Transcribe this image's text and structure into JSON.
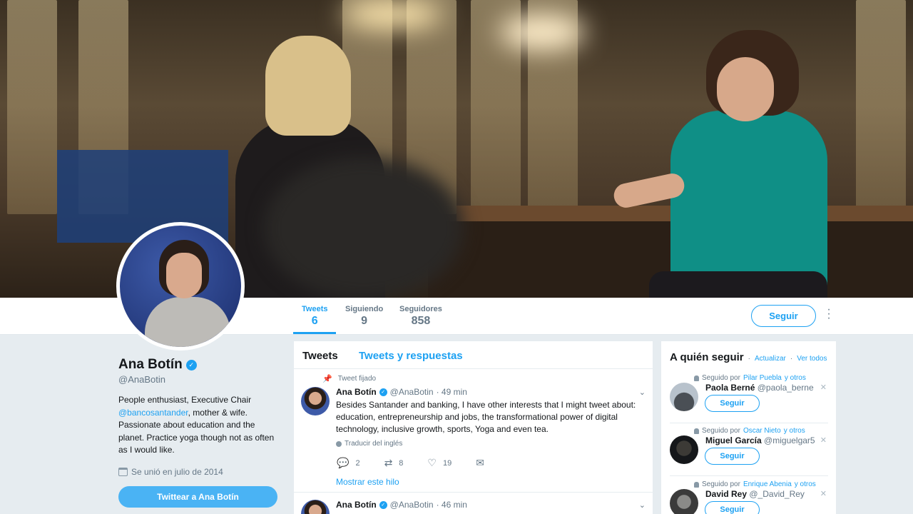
{
  "nav": {
    "tweets_label": "Tweets",
    "tweets_count": "6",
    "following_label": "Siguiendo",
    "following_count": "9",
    "followers_label": "Seguidores",
    "followers_count": "858",
    "follow_button": "Seguir"
  },
  "profile": {
    "name": "Ana Botín",
    "handle": "@AnaBotin",
    "bio_1": "People enthusiast, Executive Chair ",
    "bio_mention": "@bancosantander",
    "bio_2": ", mother & wife. Passionate about education and the planet. Practice yoga though not as often as I would like.",
    "joined": "Se unió en julio de 2014",
    "tweet_to_button": "Twittear a Ana Botín"
  },
  "timeline": {
    "tab_tweets": "Tweets",
    "tab_replies": "Tweets y respuestas",
    "tweets": [
      {
        "pinned_label": "Tweet fijado",
        "author": "Ana Botín",
        "handle": "@AnaBotin",
        "time": "· 49 min",
        "text": "Besides Santander and banking, I have other interests that I might tweet about: education, entrepreneurship and jobs, the transformational power of digital technology, inclusive growth, sports, Yoga and even tea.",
        "translate": "Traducir del inglés",
        "replies": "2",
        "retweets": "8",
        "likes": "19",
        "show_thread": "Mostrar este hilo"
      },
      {
        "author": "Ana Botín",
        "handle": "@AnaBotin",
        "time": "· 46 min"
      }
    ]
  },
  "who_to_follow": {
    "title": "A quién seguir",
    "refresh": "Actualizar",
    "view_all": "Ver todos",
    "separator": "·",
    "followed_by_label": "Seguido por",
    "and_others": "y otros",
    "follow_button": "Seguir",
    "suggestions": [
      {
        "followed_by": "Pilar Puebla",
        "name": "Paola Berné",
        "handle": "@paola_berne"
      },
      {
        "followed_by": "Oscar Nieto",
        "name": "Miguel García",
        "handle": "@miguelgar5"
      },
      {
        "followed_by": "Enrique Abenia",
        "name": "David Rey",
        "handle": "@_David_Rey"
      }
    ]
  },
  "colors": {
    "accent": "#1da1f2",
    "background": "#e6ecf0"
  }
}
